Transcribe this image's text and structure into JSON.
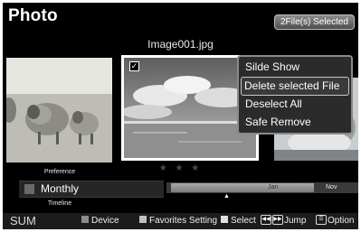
{
  "header": {
    "title": "Photo",
    "selection_badge": "2File(s) Selected"
  },
  "viewer": {
    "filename": "Image001.jpg",
    "rating": "★ ★ ★",
    "checkbox_checked": true
  },
  "context_menu": {
    "items": [
      {
        "label": "Silde Show",
        "selected": false
      },
      {
        "label": "Delete selected File",
        "selected": true
      },
      {
        "label": "Deselect All",
        "selected": false
      },
      {
        "label": "Safe Remove",
        "selected": false
      }
    ]
  },
  "timeline": {
    "preference_label": "Preference",
    "view_mode": "Monthly",
    "timeline_label": "Timeline",
    "months": {
      "current": "Jan",
      "next": "Nov"
    }
  },
  "footer": {
    "sum": "SUM",
    "device": "Device",
    "favorites": "Favorites Setting",
    "select": "Select",
    "jump": "Jump",
    "option": "Option",
    "colors": {
      "device": "#8c8c8c",
      "favorites": "#bfbfbf",
      "select": "#e0e0e0"
    }
  }
}
